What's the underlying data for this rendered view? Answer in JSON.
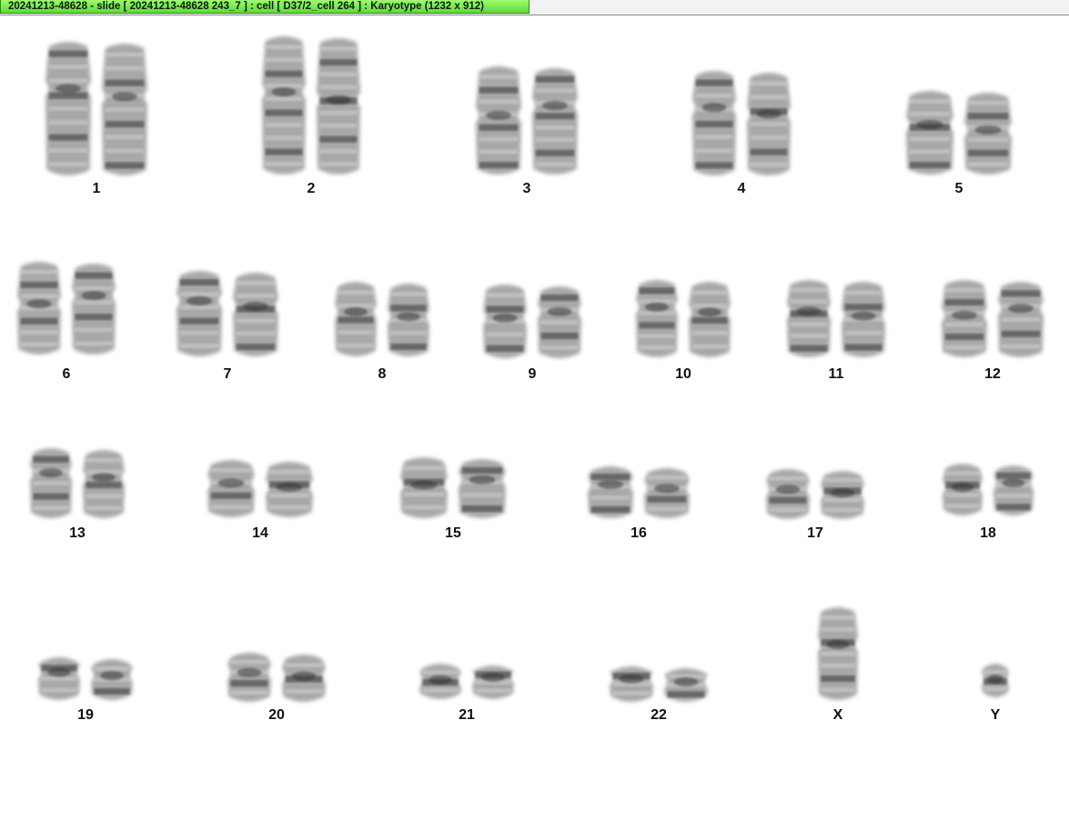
{
  "window": {
    "title": "20241213-48628 - slide [ 20241213-48628 243_7 ] : cell [ D37/2_cell 264 ] : Karyotype  (1232 x 912)",
    "accent_color": "#6ee84a"
  },
  "karyotype": {
    "chromosomes": [
      {
        "label": "1"
      },
      {
        "label": "2"
      },
      {
        "label": "3"
      },
      {
        "label": "4"
      },
      {
        "label": "5"
      },
      {
        "label": "6"
      },
      {
        "label": "7"
      },
      {
        "label": "8"
      },
      {
        "label": "9"
      },
      {
        "label": "10"
      },
      {
        "label": "11"
      },
      {
        "label": "12"
      },
      {
        "label": "13"
      },
      {
        "label": "14"
      },
      {
        "label": "15"
      },
      {
        "label": "16"
      },
      {
        "label": "17"
      },
      {
        "label": "18"
      },
      {
        "label": "19"
      },
      {
        "label": "20"
      },
      {
        "label": "21"
      },
      {
        "label": "22"
      },
      {
        "label": "X"
      },
      {
        "label": "Y"
      }
    ]
  }
}
